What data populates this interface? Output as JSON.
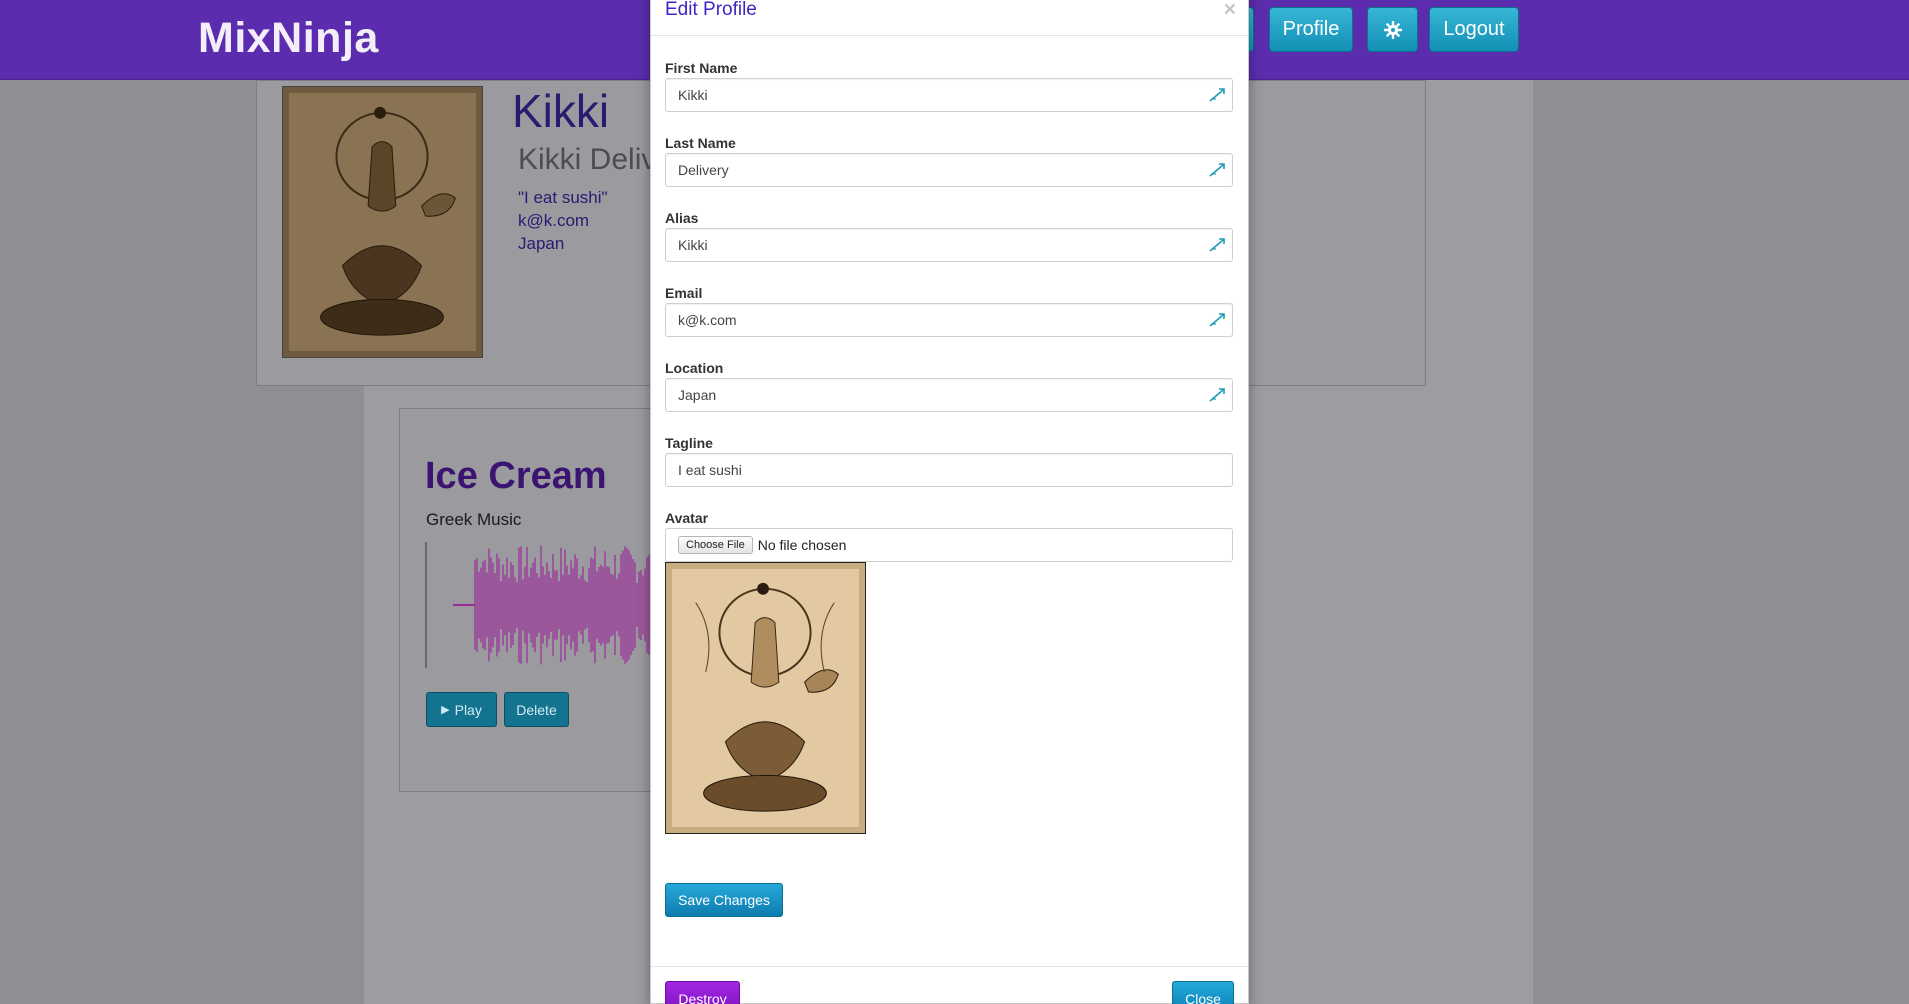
{
  "navbar": {
    "brand": "MixNinja",
    "profile_label": "Profile",
    "logout_label": "Logout",
    "settings_icon": "gear-icon"
  },
  "profile": {
    "name": "Kikki",
    "full_name": "Kikki Delive",
    "tagline": "\"I eat sushi\"",
    "email": "k@k.com",
    "location": "Japan"
  },
  "track": {
    "title": "Ice Cream",
    "genre": "Greek Music",
    "play_label": "Play",
    "delete_label": "Delete",
    "wave_color": "#9b2b9b"
  },
  "modal": {
    "title": "Edit Profile",
    "close_x": "×",
    "fields": {
      "first_name": {
        "label": "First Name",
        "value": "Kikki"
      },
      "last_name": {
        "label": "Last Name",
        "value": "Delivery"
      },
      "alias": {
        "label": "Alias",
        "value": "Kikki"
      },
      "email": {
        "label": "Email",
        "value": "k@k.com"
      },
      "location": {
        "label": "Location",
        "value": "Japan"
      },
      "tagline": {
        "label": "Tagline",
        "value": "I eat sushi"
      }
    },
    "avatar": {
      "label": "Avatar",
      "choose_label": "Choose File",
      "status": "No file chosen"
    },
    "save_label": "Save Changes",
    "destroy_label": "Destroy",
    "close_label": "Close"
  },
  "colors": {
    "navbar": "#5b2dae",
    "accent": "#1ea7c9",
    "destroy": "#8a1ad0",
    "title": "#3b27c4"
  }
}
